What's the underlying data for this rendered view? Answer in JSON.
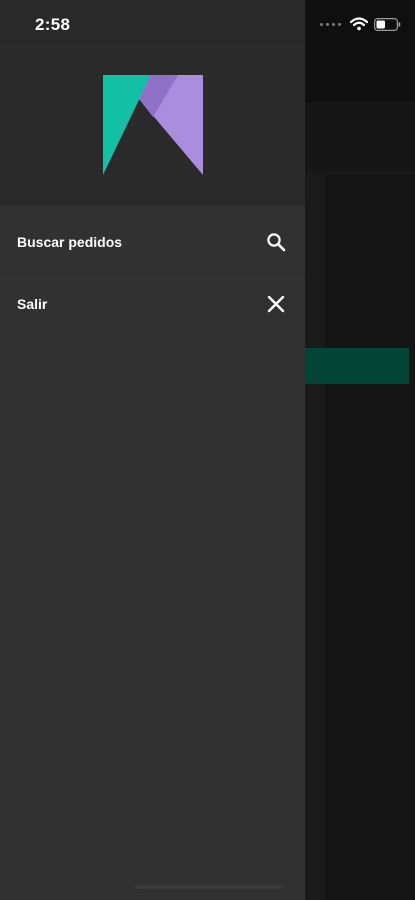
{
  "status_bar": {
    "time": "2:58",
    "icons": [
      "cellular-signal-icon",
      "wifi-icon",
      "battery-icon"
    ]
  },
  "drawer": {
    "logo_icon": "brand-logo-icon",
    "logo_colors": {
      "teal": "#12c0a5",
      "lavender": "#ab8ddf",
      "purple_overlap": "#8f72c8"
    },
    "menu": [
      {
        "label": "Buscar pedidos",
        "icon": "search-icon"
      },
      {
        "label": "Salir",
        "icon": "close-icon"
      }
    ]
  },
  "colors": {
    "drawer_background": "#313131",
    "drawer_header_background": "#2a2a2a",
    "background_app": "#151515",
    "accent_green": "#034536"
  }
}
